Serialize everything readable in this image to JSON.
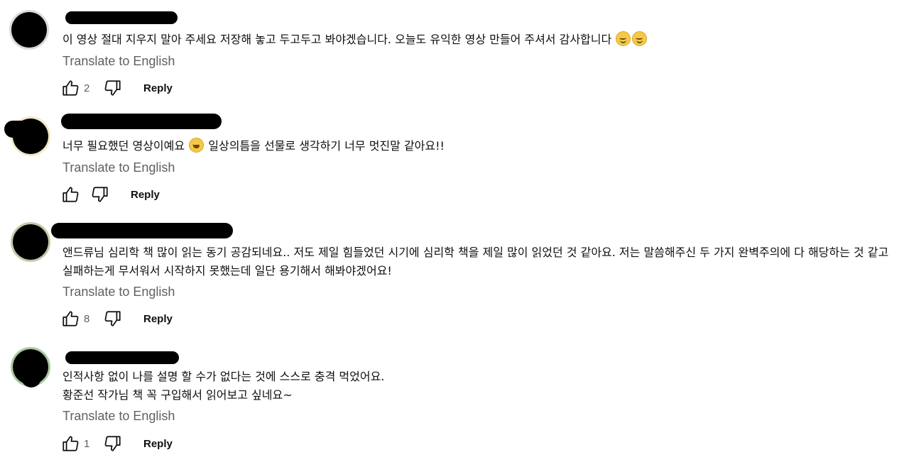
{
  "comments": [
    {
      "text": "이 영상 절대 지우지 말아 주세요 저장해 놓고 두고두고 봐야겠습니다. 오늘도 유익한 영상 만들어 주셔서 감사합니다",
      "emojis": [
        "smiling-face-icon",
        "smiling-face-icon"
      ],
      "translate_label": "Translate to English",
      "likes": "2",
      "reply_label": "Reply"
    },
    {
      "text_before": "너무 필요했던 영상이예요",
      "emoji": "grinning-face-icon",
      "text_after": "일상의틈을 선물로 생각하기 너무 멋진말 같아요!!",
      "translate_label": "Translate to English",
      "likes": "",
      "reply_label": "Reply"
    },
    {
      "text": "앤드류님 심리학 책 많이 읽는 동기 공감되네요.. 저도 제일 힘들었던 시기에 심리학 책을 제일 많이 읽었던 것 같아요. 저는 말씀해주신 두 가지 완벽주의에 다 해당하는 것 같고 실패하는게 무서워서 시작하지 못했는데 일단 용기해서 해봐야겠어요!",
      "translate_label": "Translate to English",
      "likes": "8",
      "reply_label": "Reply"
    },
    {
      "line1": "인적사항 없이 나를 설명 할 수가 없다는 것에 스스로 충격 먹었어요.",
      "line2": "황준선 작가님 책 꼭 구입해서 읽어보고 싶네요~",
      "translate_label": "Translate to English",
      "likes": "1",
      "reply_label": "Reply"
    }
  ],
  "icons": {
    "like": "thumbs-up-icon",
    "dislike": "thumbs-down-icon"
  },
  "colors": {
    "text": "#0f0f0f",
    "secondary": "#606060",
    "redaction": "#000000"
  }
}
